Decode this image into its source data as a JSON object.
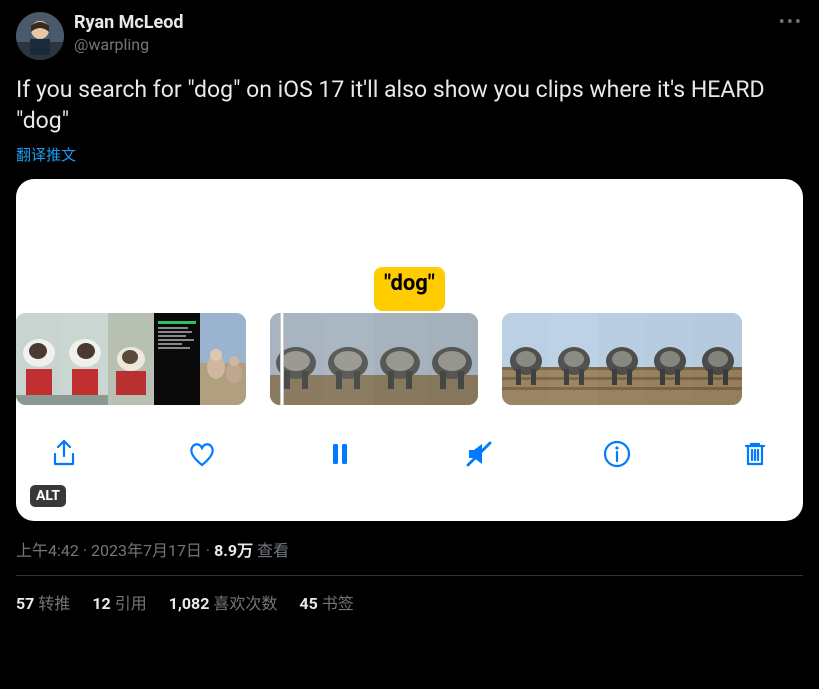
{
  "author": {
    "display_name": "Ryan McLeod",
    "handle": "@warpling"
  },
  "tweet_text": "If you search for \"dog\" on iOS 17 it'll also show you clips where it's HEARD \"dog\"",
  "translate_label": "翻译推文",
  "media": {
    "tooltip_text": "\"dog\"",
    "alt_badge": "ALT"
  },
  "meta": {
    "time": "上午4:42",
    "date": "2023年7月17日",
    "views_count": "8.9万",
    "views_label": "查看",
    "separator": " · "
  },
  "stats": {
    "retweets_count": "57",
    "retweets_label": "转推",
    "quotes_count": "12",
    "quotes_label": "引用",
    "likes_count": "1,082",
    "likes_label": "喜欢次数",
    "bookmarks_count": "45",
    "bookmarks_label": "书签"
  }
}
